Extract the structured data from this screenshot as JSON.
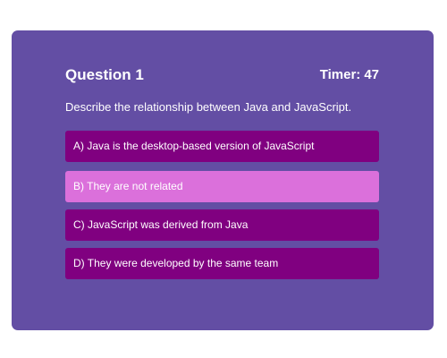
{
  "quiz": {
    "question_title": "Question 1",
    "timer": {
      "label": "Timer:",
      "value": "47"
    },
    "question_text": "Describe the relationship between Java and JavaScript.",
    "answers": [
      {
        "label": "A) Java is the desktop-based version of JavaScript",
        "selected": false
      },
      {
        "label": "B) They are not related",
        "selected": true
      },
      {
        "label": "C) JavaScript was derived from Java",
        "selected": false
      },
      {
        "label": "D) They were developed by the same team",
        "selected": false
      }
    ]
  },
  "colors": {
    "card_background": "#634ea4",
    "answer_background": "#800080",
    "answer_selected_background": "#db70db",
    "text": "#ffffff"
  }
}
